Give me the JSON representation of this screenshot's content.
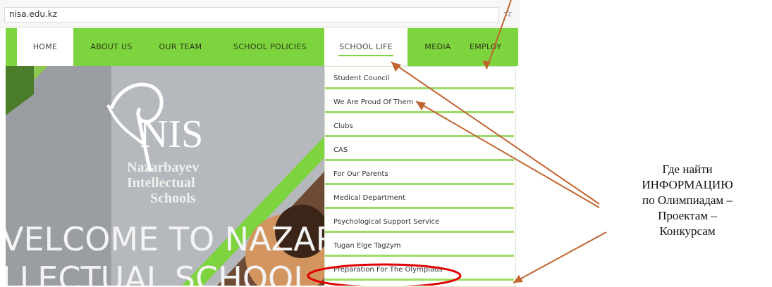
{
  "browser": {
    "url": "nisa.edu.kz",
    "star_icon": "star-icon"
  },
  "nav": {
    "items": [
      {
        "label": "HOME"
      },
      {
        "label": "ABOUT US"
      },
      {
        "label": "OUR TEAM"
      },
      {
        "label": "SCHOOL POLICIES"
      },
      {
        "label": "SCHOOL LIFE"
      },
      {
        "label": "MEDIA"
      },
      {
        "label": "EMPLOY"
      }
    ],
    "accent": "#7ed43e"
  },
  "hero": {
    "logo_big": "NIS",
    "logo_lines": [
      "Nazarbayev",
      "Intellectual",
      "Schools"
    ],
    "welcome_line1": "VELCOME TO NAZAR",
    "welcome_line2": "LLECTUAL SCHOOL"
  },
  "dropdown": {
    "items": [
      "Student Council",
      "We Are Proud Of Them",
      "Clubs",
      "CAS",
      "For Our Parents",
      "Medical Department",
      "Psychological Support Service",
      "Tugan Elge Tagzym",
      "Preparation For The Olympiads"
    ]
  },
  "annotation": {
    "lines": [
      "Где найти",
      "ИНФОРМАЦИЮ",
      "по Олимпиадам –",
      "Проектам  –",
      "Конкурсам"
    ],
    "arrow_color": "#c0642e",
    "highlight_color": "#e00000"
  }
}
